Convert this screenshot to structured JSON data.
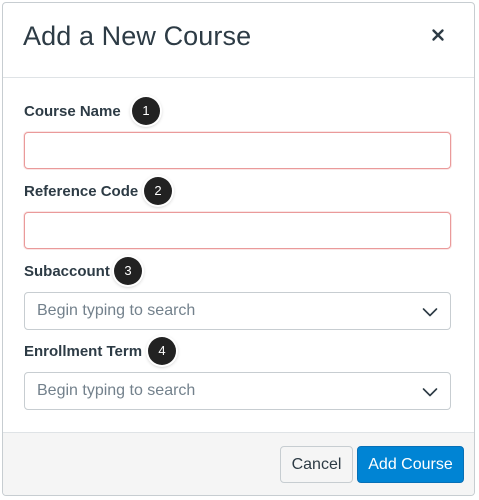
{
  "dialog": {
    "title": "Add a New Course",
    "close_icon": "close-icon"
  },
  "fields": {
    "course_name": {
      "label": "Course Name",
      "value": "",
      "callout": "1"
    },
    "reference_code": {
      "label": "Reference Code",
      "value": "",
      "callout": "2"
    },
    "subaccount": {
      "label": "Subaccount",
      "placeholder": "Begin typing to search",
      "callout": "3",
      "icon": "chevron-down-icon"
    },
    "enrollment_term": {
      "label": "Enrollment Term",
      "placeholder": "Begin typing to search",
      "callout": "4",
      "icon": "chevron-down-icon"
    }
  },
  "footer": {
    "cancel_label": "Cancel",
    "add_label": "Add Course"
  },
  "colors": {
    "primary": "#0084d4",
    "error_border": "#ea9a9a",
    "text": "#2d3b45",
    "callout_bg": "#222222"
  }
}
